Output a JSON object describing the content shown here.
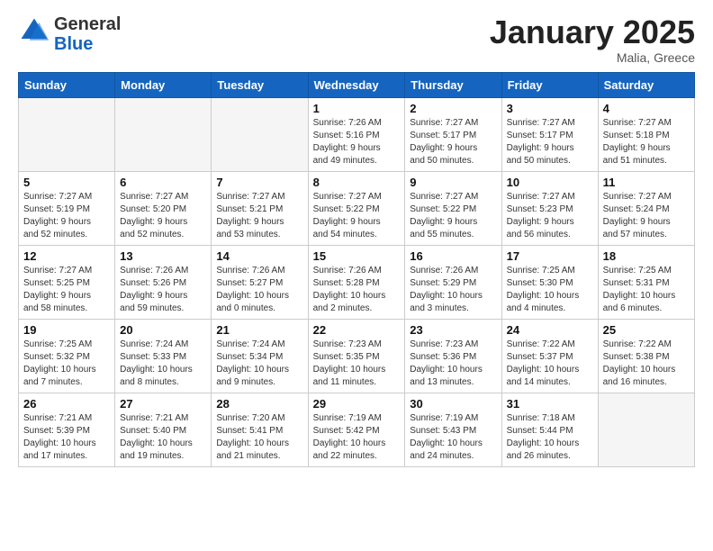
{
  "logo": {
    "general": "General",
    "blue": "Blue"
  },
  "header": {
    "month": "January 2025",
    "location": "Malia, Greece"
  },
  "weekdays": [
    "Sunday",
    "Monday",
    "Tuesday",
    "Wednesday",
    "Thursday",
    "Friday",
    "Saturday"
  ],
  "weeks": [
    [
      {
        "day": "",
        "info": ""
      },
      {
        "day": "",
        "info": ""
      },
      {
        "day": "",
        "info": ""
      },
      {
        "day": "1",
        "info": "Sunrise: 7:26 AM\nSunset: 5:16 PM\nDaylight: 9 hours\nand 49 minutes."
      },
      {
        "day": "2",
        "info": "Sunrise: 7:27 AM\nSunset: 5:17 PM\nDaylight: 9 hours\nand 50 minutes."
      },
      {
        "day": "3",
        "info": "Sunrise: 7:27 AM\nSunset: 5:17 PM\nDaylight: 9 hours\nand 50 minutes."
      },
      {
        "day": "4",
        "info": "Sunrise: 7:27 AM\nSunset: 5:18 PM\nDaylight: 9 hours\nand 51 minutes."
      }
    ],
    [
      {
        "day": "5",
        "info": "Sunrise: 7:27 AM\nSunset: 5:19 PM\nDaylight: 9 hours\nand 52 minutes."
      },
      {
        "day": "6",
        "info": "Sunrise: 7:27 AM\nSunset: 5:20 PM\nDaylight: 9 hours\nand 52 minutes."
      },
      {
        "day": "7",
        "info": "Sunrise: 7:27 AM\nSunset: 5:21 PM\nDaylight: 9 hours\nand 53 minutes."
      },
      {
        "day": "8",
        "info": "Sunrise: 7:27 AM\nSunset: 5:22 PM\nDaylight: 9 hours\nand 54 minutes."
      },
      {
        "day": "9",
        "info": "Sunrise: 7:27 AM\nSunset: 5:22 PM\nDaylight: 9 hours\nand 55 minutes."
      },
      {
        "day": "10",
        "info": "Sunrise: 7:27 AM\nSunset: 5:23 PM\nDaylight: 9 hours\nand 56 minutes."
      },
      {
        "day": "11",
        "info": "Sunrise: 7:27 AM\nSunset: 5:24 PM\nDaylight: 9 hours\nand 57 minutes."
      }
    ],
    [
      {
        "day": "12",
        "info": "Sunrise: 7:27 AM\nSunset: 5:25 PM\nDaylight: 9 hours\nand 58 minutes."
      },
      {
        "day": "13",
        "info": "Sunrise: 7:26 AM\nSunset: 5:26 PM\nDaylight: 9 hours\nand 59 minutes."
      },
      {
        "day": "14",
        "info": "Sunrise: 7:26 AM\nSunset: 5:27 PM\nDaylight: 10 hours\nand 0 minutes."
      },
      {
        "day": "15",
        "info": "Sunrise: 7:26 AM\nSunset: 5:28 PM\nDaylight: 10 hours\nand 2 minutes."
      },
      {
        "day": "16",
        "info": "Sunrise: 7:26 AM\nSunset: 5:29 PM\nDaylight: 10 hours\nand 3 minutes."
      },
      {
        "day": "17",
        "info": "Sunrise: 7:25 AM\nSunset: 5:30 PM\nDaylight: 10 hours\nand 4 minutes."
      },
      {
        "day": "18",
        "info": "Sunrise: 7:25 AM\nSunset: 5:31 PM\nDaylight: 10 hours\nand 6 minutes."
      }
    ],
    [
      {
        "day": "19",
        "info": "Sunrise: 7:25 AM\nSunset: 5:32 PM\nDaylight: 10 hours\nand 7 minutes."
      },
      {
        "day": "20",
        "info": "Sunrise: 7:24 AM\nSunset: 5:33 PM\nDaylight: 10 hours\nand 8 minutes."
      },
      {
        "day": "21",
        "info": "Sunrise: 7:24 AM\nSunset: 5:34 PM\nDaylight: 10 hours\nand 9 minutes."
      },
      {
        "day": "22",
        "info": "Sunrise: 7:23 AM\nSunset: 5:35 PM\nDaylight: 10 hours\nand 11 minutes."
      },
      {
        "day": "23",
        "info": "Sunrise: 7:23 AM\nSunset: 5:36 PM\nDaylight: 10 hours\nand 13 minutes."
      },
      {
        "day": "24",
        "info": "Sunrise: 7:22 AM\nSunset: 5:37 PM\nDaylight: 10 hours\nand 14 minutes."
      },
      {
        "day": "25",
        "info": "Sunrise: 7:22 AM\nSunset: 5:38 PM\nDaylight: 10 hours\nand 16 minutes."
      }
    ],
    [
      {
        "day": "26",
        "info": "Sunrise: 7:21 AM\nSunset: 5:39 PM\nDaylight: 10 hours\nand 17 minutes."
      },
      {
        "day": "27",
        "info": "Sunrise: 7:21 AM\nSunset: 5:40 PM\nDaylight: 10 hours\nand 19 minutes."
      },
      {
        "day": "28",
        "info": "Sunrise: 7:20 AM\nSunset: 5:41 PM\nDaylight: 10 hours\nand 21 minutes."
      },
      {
        "day": "29",
        "info": "Sunrise: 7:19 AM\nSunset: 5:42 PM\nDaylight: 10 hours\nand 22 minutes."
      },
      {
        "day": "30",
        "info": "Sunrise: 7:19 AM\nSunset: 5:43 PM\nDaylight: 10 hours\nand 24 minutes."
      },
      {
        "day": "31",
        "info": "Sunrise: 7:18 AM\nSunset: 5:44 PM\nDaylight: 10 hours\nand 26 minutes."
      },
      {
        "day": "",
        "info": ""
      }
    ]
  ]
}
